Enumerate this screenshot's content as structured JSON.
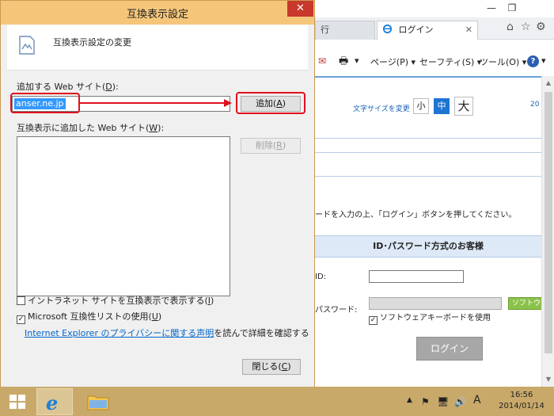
{
  "dialog": {
    "title": "互換表示設定",
    "close_glyph": "✕",
    "header": "互換表示設定の変更",
    "add_site_label_prefix": "追加する Web サイト(",
    "add_site_label_key": "D",
    "add_site_label_suffix": "):",
    "site_input_value": "anser.ne.jp",
    "add_button_prefix": "追加(",
    "add_button_key": "A",
    "add_button_suffix": ")",
    "list_label_prefix": "互換表示に追加した Web サイト(",
    "list_label_key": "W",
    "list_label_suffix": "):",
    "remove_button_prefix": "削除(",
    "remove_button_key": "R",
    "remove_button_suffix": ")",
    "intranet_option_prefix": "イントラネット サイトを互換表示で表示する(",
    "intranet_option_key": "I",
    "intranet_option_suffix": ")",
    "intranet_checked": false,
    "mslist_option_prefix": "Microsoft 互換性リストの使用(",
    "mslist_option_key": "U",
    "mslist_option_suffix": ")",
    "mslist_checked": true,
    "privacy_link_text": "Internet Explorer のプライバシーに関する声明",
    "privacy_suffix": "を読んで詳細を確認する",
    "close_button_prefix": "閉じる(",
    "close_button_key": "C",
    "close_button_suffix": ")"
  },
  "browser": {
    "tab_inactive_label": "行",
    "tab_active_label": "ログイン",
    "tab_close_glyph": "✕",
    "window_controls": [
      "—",
      "❐"
    ],
    "toolbar_icons": [
      "⌂",
      "☆",
      "⚙"
    ],
    "commands": {
      "page": "ページ(P) ▾",
      "safety": "セーフティ(S) ▾",
      "tools": "ツール(O) ▾",
      "help": "?",
      "help_arrow": "▾",
      "mail_icon": "✉",
      "print_icon": "🖶",
      "print_arrow": "▾"
    },
    "page": {
      "font_size_label": "文字サイズを変更",
      "font_small": "小",
      "font_medium": "中",
      "font_large": "大",
      "year_fragment": "20",
      "instruction": "ードを入力の上、「ログイン」ボタンを押してください。",
      "id_password_header": "ID･パスワード方式のお客様",
      "id_label": "ID:",
      "password_label": "パスワード:",
      "software_keyboard_badge": "ソフトウェ",
      "software_keyboard_check": "ソフトウェアキーボードを使用",
      "software_keyboard_checked": true,
      "login_button": "ログイン"
    }
  },
  "taskbar": {
    "tray_icons": [
      "▲",
      "⚑",
      "🖥",
      "🔊",
      "A"
    ],
    "time": "16:56",
    "date": "2014/01/14"
  },
  "colors": {
    "dialog_title_bar": "#f5c67a",
    "close_red": "#c8382b",
    "highlight_red": "#e0101e",
    "selection_blue": "#3399ff",
    "link_blue": "#0066cc",
    "taskbar": "#c9a96a",
    "login_button_gray": "#a7a7a7",
    "software_badge_green": "#8bc34a"
  }
}
